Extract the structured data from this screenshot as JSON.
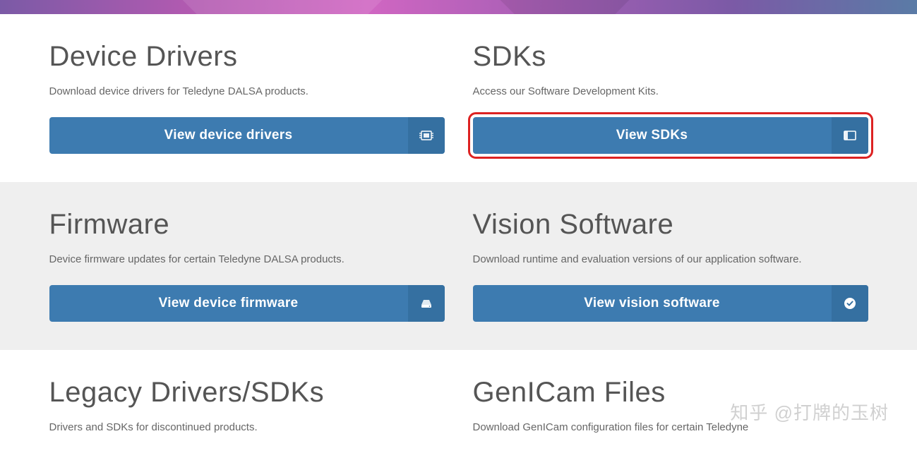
{
  "sections": {
    "device_drivers": {
      "title": "Device Drivers",
      "desc": "Download device drivers for Teledyne DALSA products.",
      "button": "View device drivers",
      "icon": "chip-icon"
    },
    "sdks": {
      "title": "SDKs",
      "desc": "Access our Software Development Kits.",
      "button": "View SDKs",
      "icon": "window-icon",
      "highlighted": true
    },
    "firmware": {
      "title": "Firmware",
      "desc": "Device firmware updates for certain Teledyne DALSA products.",
      "button": "View device firmware",
      "icon": "storage-icon"
    },
    "vision_software": {
      "title": "Vision Software",
      "desc": "Download runtime and evaluation versions of our application software.",
      "button": "View vision software",
      "icon": "check-circle-icon"
    },
    "legacy": {
      "title": "Legacy Drivers/SDKs",
      "desc": "Drivers and SDKs for discontinued products."
    },
    "genicam": {
      "title": "GenICam Files",
      "desc": "Download GenICam configuration files for certain Teledyne"
    }
  },
  "watermark": "知乎 @打牌的玉树"
}
